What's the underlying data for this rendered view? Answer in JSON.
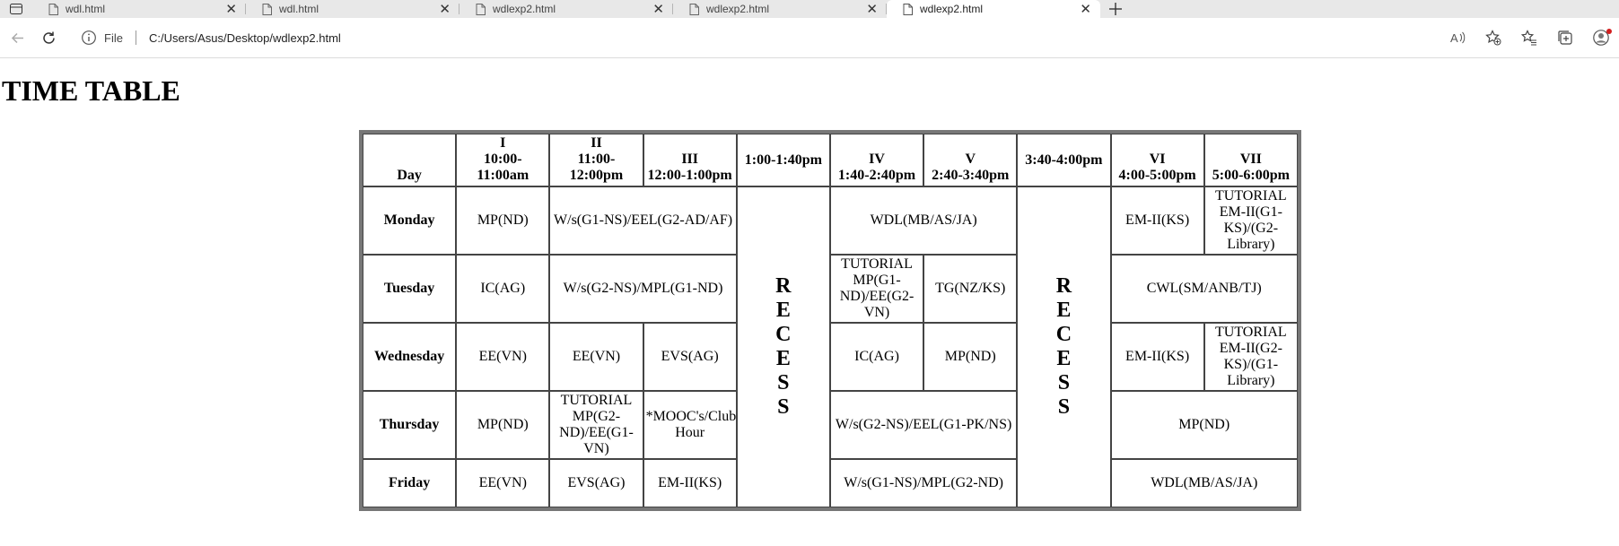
{
  "browser": {
    "tabs": [
      {
        "label": "wdl.html",
        "active": false
      },
      {
        "label": "wdl.html",
        "active": false
      },
      {
        "label": "wdlexp2.html",
        "active": false
      },
      {
        "label": "wdlexp2.html",
        "active": false
      },
      {
        "label": "wdlexp2.html",
        "active": true
      }
    ],
    "new_tab_icon": "plus-icon",
    "scheme_label": "File",
    "url": "C:/Users/Asus/Desktop/wdlexp2.html"
  },
  "page": {
    "title": "TIME TABLE"
  },
  "timetable": {
    "headers": {
      "day": "Day",
      "p1_num": "I",
      "p1_time": "10:00-11:00am",
      "p2_num": "II",
      "p2_time": "11:00-12:00pm",
      "p3_num": "III",
      "p3_time": "12:00-1:00pm",
      "break1": "1:00-1:40pm",
      "p4_num": "IV",
      "p4_time": "1:40-2:40pm",
      "p5_num": "V",
      "p5_time": "2:40-3:40pm",
      "break2": "3:40-4:00pm",
      "p6_num": "VI",
      "p6_time": "4:00-5:00pm",
      "p7_num": "VII",
      "p7_time": "5:00-6:00pm"
    },
    "recess": "RECESS",
    "monday": {
      "day": "Monday",
      "p1": "MP(ND)",
      "p2_3": "W/s(G1-NS)/EEL(G2-AD/AF)",
      "p4_5": "WDL(MB/AS/JA)",
      "p6": "EM-II(KS)",
      "p7": "TUTORIAL EM-II(G1-KS)/(G2-Library)"
    },
    "tuesday": {
      "day": "Tuesday",
      "p1": "IC(AG)",
      "p2_3": "W/s(G2-NS)/MPL(G1-ND)",
      "p4": "TUTORIAL MP(G1-ND)/EE(G2-VN)",
      "p5": "TG(NZ/KS)",
      "p6_7": "CWL(SM/ANB/TJ)"
    },
    "wednesday": {
      "day": "Wednesday",
      "p1": "EE(VN)",
      "p2": "EE(VN)",
      "p3": "EVS(AG)",
      "p4": "IC(AG)",
      "p5": "MP(ND)",
      "p6": "EM-II(KS)",
      "p7": "TUTORIAL EM-II(G2-KS)/(G1-Library)"
    },
    "thursday": {
      "day": "Thursday",
      "p1": "MP(ND)",
      "p2": "TUTORIAL MP(G2-ND)/EE(G1-VN)",
      "p3": "*MOOC's/Club Hour",
      "p4_5": "W/s(G2-NS)/EEL(G1-PK/NS)",
      "p6_7": "MP(ND)"
    },
    "friday": {
      "day": "Friday",
      "p1": "EE(VN)",
      "p2": "EVS(AG)",
      "p3": "EM-II(KS)",
      "p4_5": "W/s(G1-NS)/MPL(G2-ND)",
      "p6_7": "WDL(MB/AS/JA)"
    }
  }
}
